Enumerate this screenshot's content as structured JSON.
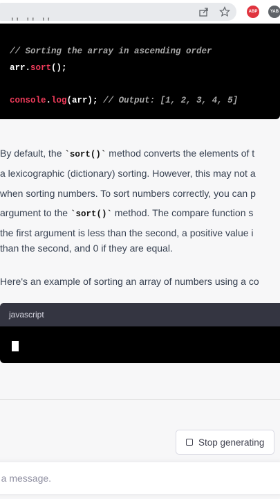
{
  "browser": {
    "icons": [
      "share-icon",
      "star-icon"
    ],
    "extensions": [
      {
        "label": "ABP",
        "color": "#e0343f"
      },
      {
        "label": "YAB",
        "color": "#5f6368"
      }
    ]
  },
  "code_block_1": {
    "header_partial": "'' '' ''",
    "comment_line": "// Sorting the array in ascending order",
    "line2": {
      "a": "arr.",
      "b": "sort",
      "c": "();"
    },
    "line3": {
      "a": "console",
      "b": ".",
      "c": "log",
      "d": "(arr); ",
      "e": "// Output: [1, 2, 3, 4, 5]"
    }
  },
  "prose": {
    "p1": [
      {
        "pre": "By default, the ",
        "code": "`sort()`",
        "post": " method converts the elements of t"
      },
      {
        "pre": "a lexicographic (dictionary) sorting. However, this may not a"
      },
      {
        "pre": "when sorting numbers. To sort numbers correctly, you can p"
      },
      {
        "pre": "argument to the ",
        "code": "`sort()`",
        "post": " method. The compare function s"
      },
      {
        "pre": "the first argument is less than the second, a positive value i"
      },
      {
        "pre": "than the second, and 0 if they are equal."
      }
    ],
    "p2": "Here's an example of sorting an array of numbers using a co"
  },
  "code_block_2": {
    "language": "javascript"
  },
  "stop_button": {
    "label": "Stop generating"
  },
  "composer": {
    "placeholder": "d a message."
  }
}
